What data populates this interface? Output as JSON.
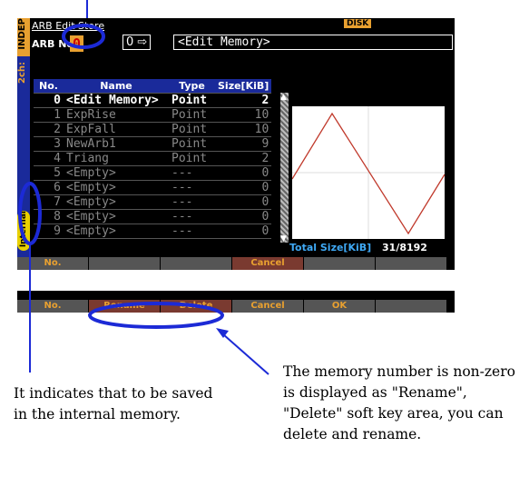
{
  "header": {
    "title": "ARB Edit  Store",
    "disk_label": "DISK",
    "arb_no_label": "ARB No.",
    "arb_no_value": "0",
    "dest_from": "0",
    "dest_target": "<Edit Memory>"
  },
  "side": {
    "top_label": "INDEP",
    "ch_label": "2ch:",
    "storage_label": "Internal"
  },
  "table": {
    "headers": [
      "No.",
      "Name",
      "Type",
      "Size[KiB]"
    ],
    "rows": [
      {
        "no": "0",
        "name": "<Edit Memory>",
        "type": "Point",
        "size": "2"
      },
      {
        "no": "1",
        "name": "ExpRise",
        "type": "Point",
        "size": "10"
      },
      {
        "no": "2",
        "name": "ExpFall",
        "type": "Point",
        "size": "10"
      },
      {
        "no": "3",
        "name": "NewArb1",
        "type": "Point",
        "size": "9"
      },
      {
        "no": "4",
        "name": "Triang",
        "type": "Point",
        "size": "2"
      },
      {
        "no": "5",
        "name": "<Empty>",
        "type": "---",
        "size": "0"
      },
      {
        "no": "6",
        "name": "<Empty>",
        "type": "---",
        "size": "0"
      },
      {
        "no": "7",
        "name": "<Empty>",
        "type": "---",
        "size": "0"
      },
      {
        "no": "8",
        "name": "<Empty>",
        "type": "---",
        "size": "0"
      },
      {
        "no": "9",
        "name": "<Empty>",
        "type": "---",
        "size": "0"
      }
    ]
  },
  "total": {
    "label": "Total Size[KiB]",
    "used": "31",
    "capacity": "/8192"
  },
  "softkeys_top": [
    "No.",
    "",
    "",
    "Cancel",
    "",
    ""
  ],
  "softkeys_bottom": [
    "No.",
    "Rename",
    "Delete",
    "Cancel",
    "OK",
    ""
  ],
  "annotations": {
    "left": "It indicates that to be saved in the internal memory.",
    "right": "The memory number is non-zero is displayed as \"Rename\", \"Delete\" soft key area, you can delete and rename."
  },
  "colors": {
    "accent": "#1c2ad6",
    "softkey_text": "#e8a030",
    "wave": "#c0392b"
  }
}
